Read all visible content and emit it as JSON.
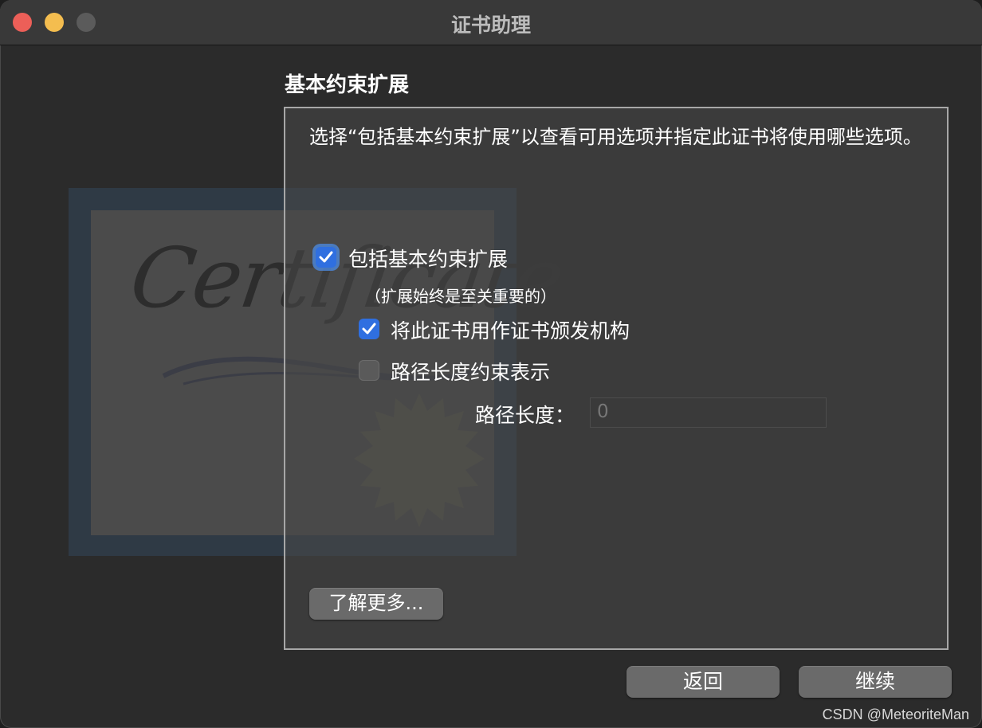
{
  "window": {
    "title": "证书助理"
  },
  "section": {
    "title": "基本约束扩展",
    "description": "选择“包括基本约束扩展”以查看可用选项并指定此证书将使用哪些选项。"
  },
  "background_art": {
    "certificate_text": "Certificate"
  },
  "options": {
    "include_basic_constraints": {
      "label": "包括基本约束扩展",
      "checked": true
    },
    "note": "（扩展始终是至关重要的）",
    "use_as_ca": {
      "label": "将此证书用作证书颁发机构",
      "checked": true
    },
    "path_length_constraint": {
      "label": "路径长度约束表示",
      "checked": false
    },
    "path_length": {
      "label": "路径长度：",
      "value": "0"
    }
  },
  "buttons": {
    "learn_more": "了解更多...",
    "back": "返回",
    "continue": "继续"
  },
  "watermark": "CSDN @MeteoriteMan",
  "colors": {
    "accent": "#2f6fe0",
    "close": "#ec5f58",
    "minimize": "#f4bd4f"
  }
}
